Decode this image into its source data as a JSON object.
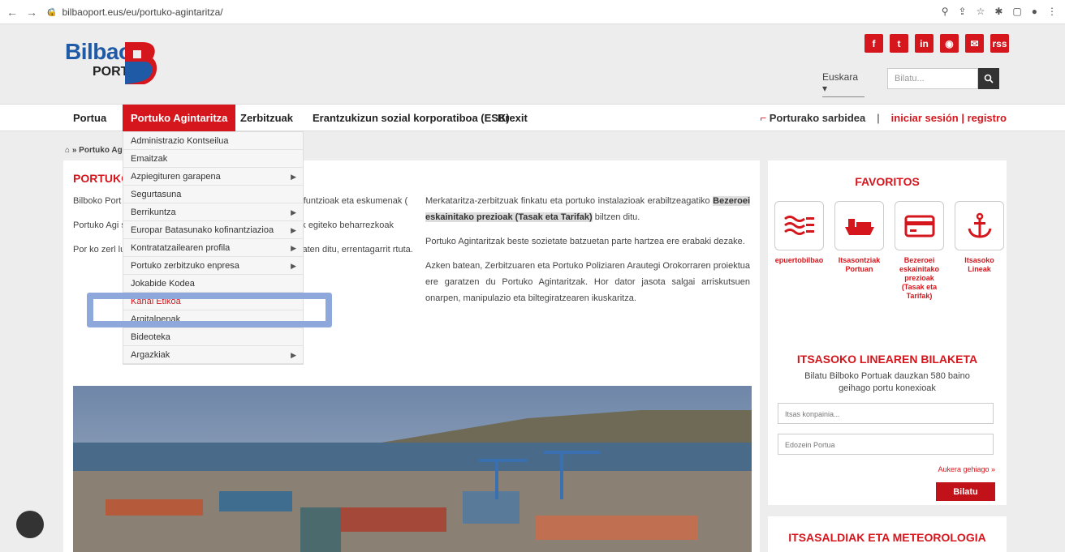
{
  "browser": {
    "url": "bilbaoport.eus/eu/portuko-agintaritza/",
    "back": "←",
    "forward": "→",
    "reload": "C"
  },
  "header": {
    "logo_word": "Bilbao",
    "logo_port": "PORT",
    "social": [
      "f",
      "t",
      "in",
      "◉",
      "✉",
      "rss"
    ],
    "language": "Euskara ▾",
    "search_placeholder": "Bilatu...",
    "search_icon": "search-icon"
  },
  "nav": {
    "items": [
      "Portua",
      "Portuko Agintaritza",
      "Zerbitzuak",
      "Erantzukizun sozial korporatiboa (ESK)",
      "Brexit"
    ],
    "access_label": "Porturako sarbidea",
    "separator": "|",
    "login_label": "iniciar sesión | registro"
  },
  "breadcrumb": "» Portuko Ag",
  "dropdown": [
    {
      "label": "Administrazio Kontseilua",
      "arrow": false
    },
    {
      "label": "Emaitzak",
      "arrow": false
    },
    {
      "label": "Azpiegituren garapena",
      "arrow": true
    },
    {
      "label": "Segurtasuna",
      "arrow": false
    },
    {
      "label": "Berrikuntza",
      "arrow": true
    },
    {
      "label": "Europar Batasunako kofinantziazioa",
      "arrow": true
    },
    {
      "label": "Kontratatzailearen profila",
      "arrow": true
    },
    {
      "label": "Portuko zerbitzuko enpresa mailegatzaileak",
      "arrow": true
    },
    {
      "label": "Jokabide Kodea",
      "arrow": false
    },
    {
      "label": "Kanal Etikoa",
      "arrow": false
    },
    {
      "label": "Argitalpenak",
      "arrow": false
    },
    {
      "label": "Bideoteka",
      "arrow": false
    },
    {
      "label": "Argazkiak",
      "arrow": true
    }
  ],
  "content": {
    "title": "PORTUKO",
    "left_p1": "Bilboko Port                                        rtua. Estatuko Portuak erakunde pu                                        zarritako funtzioak eta eskumenak (",
    "left_p2": "Portuko Agi                                        salgaien itsasoko joan-etorriekin (                                        ko jarduerak egiteko beharrezkoak",
    "left_p3": "Por      ko zerl                                        lu eta portuko jabetza publikoa ku                                        aimenak ematen ditu, errentagarrit                                        rtuta.",
    "right_p1_a": "Merkataritza-zerbitzuak finkatu eta portuko instalazioak erabiltzeagatiko ",
    "right_p1_hl": "Bezeroei eskainitako prezioak (Tasak eta Tarifak)",
    "right_p1_b": " biltzen ditu.",
    "right_p2": "Portuko Agintaritzak beste sozietate batzuetan parte hartzea ere erabaki dezake.",
    "right_p3": "Azken batean, Zerbitzuaren eta Portuko Poliziaren Arautegi Orokorraren proiektua ere garatzen du Portuko Agintaritzak. Hor dator jasota salgai arriskutsuen onarpen, manipulazio eta biltegiratzearen ikuskaritza."
  },
  "favoritos": {
    "title": "FAVORITOS",
    "items": [
      "epuertobilbao",
      "Itsasontziak Portuan",
      "Bezeroei eskainitako prezioak (Tasak eta Tarifak)",
      "Itsasoko Lineak"
    ]
  },
  "lineak": {
    "title": "ITSASOKO LINEAREN BILAKETA",
    "desc": "Bilatu Bilboko Portuak dauzkan 580 baino geihago portu konexioak",
    "company_placeholder": "Itsas konpainia...",
    "port_value": "Edozein Portua",
    "more": "Aukera gehiago »",
    "button": "Bilatu"
  },
  "meteo": {
    "title": "ITSASALDIAK ETA METEOROLOGIA"
  }
}
